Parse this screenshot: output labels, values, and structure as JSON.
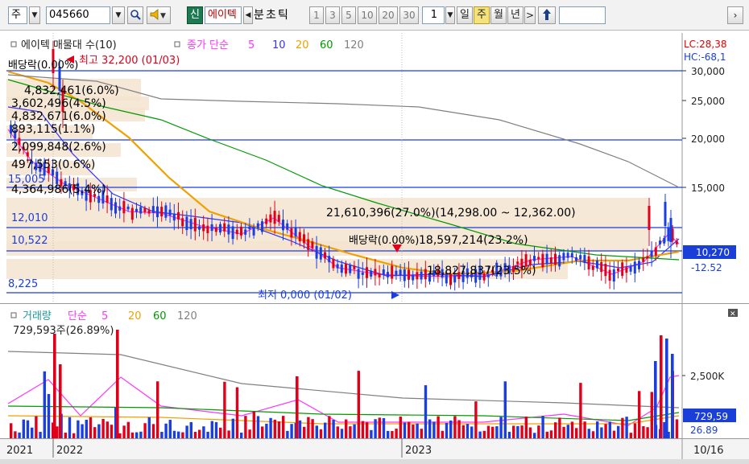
{
  "toolbar": {
    "market": "주",
    "code": "045660",
    "credit_badge": "신",
    "stock_name": "에이텍",
    "tabs": [
      "분",
      "초",
      "틱"
    ],
    "intervals": [
      "1",
      "3",
      "5",
      "10",
      "20",
      "30"
    ],
    "count": "1",
    "periods": [
      "일",
      "주",
      "월",
      "년"
    ],
    "selected_period": "주"
  },
  "price_chart": {
    "header": {
      "title": "에이텍 매물대 수(10)",
      "ma_label": "종가 단순",
      "ma_periods": [
        "5",
        "10",
        "20",
        "60",
        "120"
      ]
    },
    "ma_colors": {
      "5": "#ff33ff",
      "10": "#3333ff",
      "20": "#f0a000",
      "60": "#009900",
      "120": "#808080"
    },
    "corner": {
      "lc": "LC:28,38",
      "hc": "HC:-68,1"
    },
    "y_ticks": [
      "30,000",
      "25,000",
      "20,000",
      "15,000"
    ],
    "current_price": "10,270",
    "current_change": "-12.52",
    "high_marker": "최고 32,200 (01/03)",
    "low_marker": "최저 0,000 (01/02)",
    "dividend_labels": [
      "배당락(0.00%)",
      "배당락(0.00%)"
    ],
    "level_labels": [
      "15,005",
      "12,010",
      "10,522",
      "8,225"
    ],
    "volume_profile": [
      "4,832,461(6.0%)",
      "3,602,496(4.5%)",
      "4,832,671(6.0%)",
      "893,115(1.1%)",
      "2,099,848(2.6%)",
      "497,553(0.6%)",
      "4,364,986(5.4%)",
      "21,610,396(27.0%)(14,298.00 ~ 12,362.00)",
      "18,597,214(23.2%)",
      "18,827,837(23.5%)"
    ]
  },
  "volume_chart": {
    "header": {
      "title": "거래량",
      "ma_label": "단순",
      "ma_periods": [
        "5",
        "20",
        "60",
        "120"
      ]
    },
    "max_label": "729,593주(26.89%)",
    "y_tick": "2,500K",
    "current_volume": "729,59",
    "current_pct": "26.89"
  },
  "date_axis": {
    "labels": [
      "2021",
      "2022",
      "2023"
    ],
    "end_label": "10/16"
  }
}
